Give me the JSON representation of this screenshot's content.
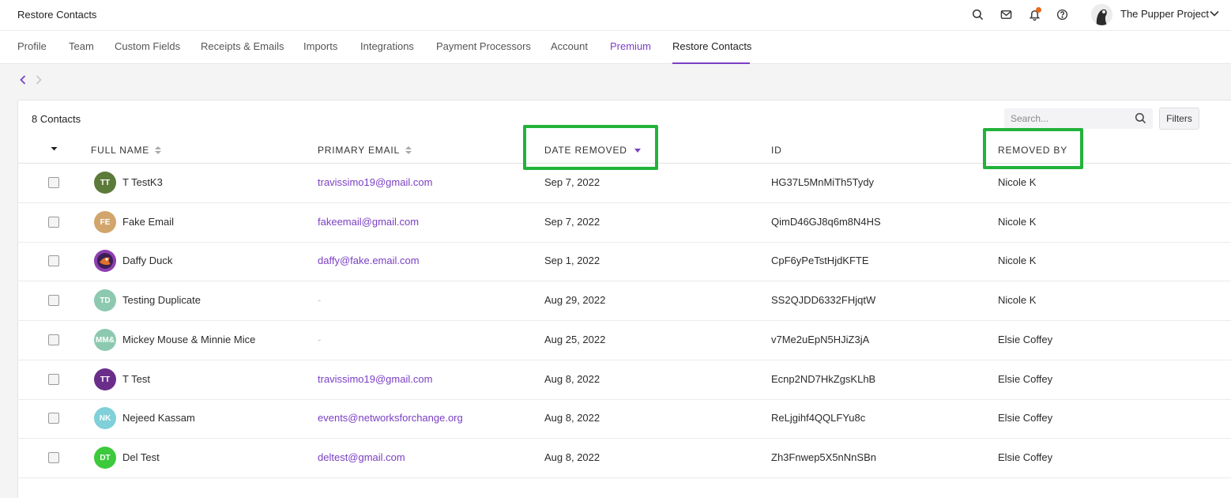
{
  "app": {
    "title": "Restore Contacts"
  },
  "topbar": {
    "org_name": "The Pupper Project",
    "icons": [
      "search-icon",
      "mail-icon",
      "bell-icon",
      "help-icon",
      "chevron-down-icon"
    ],
    "notification_dot_color": "#e66a1e"
  },
  "tabs": [
    {
      "label": "Profile"
    },
    {
      "label": "Team"
    },
    {
      "label": "Custom Fields"
    },
    {
      "label": "Receipts & Emails"
    },
    {
      "label": "Imports"
    },
    {
      "label": "Integrations"
    },
    {
      "label": "Payment Processors"
    },
    {
      "label": "Account"
    },
    {
      "label": "Premium"
    },
    {
      "label": "Restore Contacts"
    }
  ],
  "active_tab": "Restore Contacts",
  "accent_color": "#7b3fc4",
  "highlight_color": "#22b33a",
  "table": {
    "count_label": "8 Contacts",
    "search_placeholder": "Search...",
    "filters_label": "Filters",
    "sorted_by": "DATE REMOVED",
    "columns": {
      "full_name": "FULL NAME",
      "primary_email": "PRIMARY EMAIL",
      "date_removed": "DATE REMOVED",
      "id": "ID",
      "removed_by": "REMOVED BY"
    },
    "rows": [
      {
        "initials": "TT",
        "avatar_color": "#5c7a3a",
        "name": "T TestK3",
        "email": "travissimo19@gmail.com",
        "date": "Sep 7, 2022",
        "id": "HG37L5MnMiTh5Tydy",
        "removed_by": "Nicole K"
      },
      {
        "initials": "FE",
        "avatar_color": "#d2a56c",
        "name": "Fake Email",
        "email": "fakeemail@gmail.com",
        "date": "Sep 7, 2022",
        "id": "QimD46GJ8q6m8N4HS",
        "removed_by": "Nicole K"
      },
      {
        "initials": "",
        "avatar_color": "#8e3fb0",
        "name": "Daffy Duck",
        "email": "daffy@fake.email.com",
        "date": "Sep 1, 2022",
        "id": "CpF6yPeTstHjdKFTE",
        "removed_by": "Nicole K"
      },
      {
        "initials": "TD",
        "avatar_color": "#8cc9b0",
        "name": "Testing Duplicate",
        "email": "-",
        "date": "Aug 29, 2022",
        "id": "SS2QJDD6332FHjqtW",
        "removed_by": "Nicole K"
      },
      {
        "initials": "MM&",
        "avatar_color": "#8cc9b0",
        "name": "Mickey Mouse & Minnie Mice",
        "email": "-",
        "date": "Aug 25, 2022",
        "id": "v7Me2uEpN5HJiZ3jA",
        "removed_by": "Elsie Coffey"
      },
      {
        "initials": "TT",
        "avatar_color": "#6a2d8a",
        "name": "T Test",
        "email": "travissimo19@gmail.com",
        "date": "Aug 8, 2022",
        "id": "Ecnp2ND7HkZgsKLhB",
        "removed_by": "Elsie Coffey"
      },
      {
        "initials": "NK",
        "avatar_color": "#7fd0d8",
        "name": "Nejeed Kassam",
        "email": "events@networksforchange.org",
        "date": "Aug 8, 2022",
        "id": "ReLjgihf4QQLFYu8c",
        "removed_by": "Elsie Coffey"
      },
      {
        "initials": "DT",
        "avatar_color": "#3cc93c",
        "name": "Del Test",
        "email": "deltest@gmail.com",
        "date": "Aug 8, 2022",
        "id": "Zh3Fnwep5X5nNnSBn",
        "removed_by": "Elsie Coffey"
      }
    ]
  }
}
